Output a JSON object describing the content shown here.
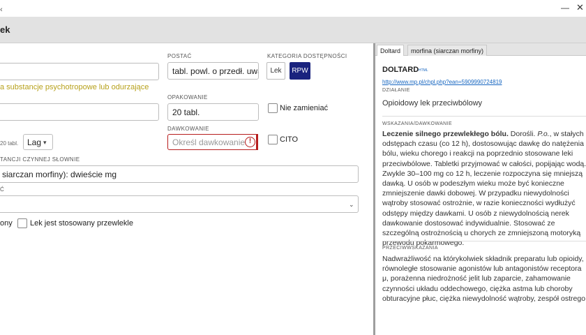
{
  "window": {
    "title_fragment": "ek"
  },
  "form": {
    "postac_label": "POSTAĆ",
    "postac_value": "tabl. powl. o przedł. uwaln",
    "kategoria_label": "KATEGORIA DOSTĘPNOŚCI",
    "kategoria_options": [
      "Lek",
      "RPW"
    ],
    "kategoria_selected": "RPW",
    "warning_text": "a substancje psychotropowe lub odurzające",
    "opakowanie_label": "OPAKOWANIE",
    "opakowanie_value": "20 tabl.",
    "nie_zamieniac_label": "Nie zamieniać",
    "dawkowanie_label": "DAWKOWANIE",
    "dawkowanie_placeholder": "Określ dawkowanie",
    "cito_label": "CITO",
    "pack_small": "20 tabl.",
    "unit_select_value": "Lag",
    "substancja_label": "TANCJI CZYNNEJ SŁOWNIE",
    "substancja_value": "siarczan morfiny): dwieście mg",
    "field_c_label": "Ć",
    "chk_left_label": "ony",
    "przewlekle_label": "Lek jest stosowany przewlekle"
  },
  "right_panel": {
    "tabs": [
      "Doltard",
      "morfina (siarczan morfiny)"
    ],
    "active_tab": "Doltard",
    "drug_name": "DOLTARD",
    "drug_badge": "HTML",
    "drug_link": "http://www.mp.pl/chpl.php?ean=5909990724819",
    "dzialanie_label": "DZIAŁANIE",
    "dzialanie_text": "Opioidowy lek przeciwbólowy",
    "wskazania_label": "WSKAZANIA/DAWKOWANIE",
    "wskazania_heading": "Leczenie silnego przewlekłego bólu.",
    "wskazania_adults": "Dorośli.",
    "wskazania_po": "P.o.",
    "wskazania_rest": ", w stałych odstępach czasu (co 12 h), dostosowując dawkę do natężenia bólu, wieku chorego i reakcji na poprzednio stosowane leki przeciwbólowe. Tabletki przyjmować w całości, popijając wodą. Zwykle 30–100 mg co 12 h, leczenie rozpoczyna się mniejszą dawką. U osób w podeszłym wieku może być konieczne zmniejszenie dawki dobowej. W przypadku niewydolności wątroby stosować ostrożnie, w razie konieczności wydłużyć odstępy między dawkami. U osób z niewydolnością nerek dawkowanie dostosować indywidualnie. Stosować ze szczególną ostrożnością u chorych ze zmniejszoną motoryką przewodu pokarmowego.",
    "przeciw_label": "PRZECIWWSKAZANIA",
    "przeciw_text": "Nadwrażliwość na którykolwiek składnik preparatu lub opioidy, równoległe stosowanie agonistów lub antagonistów receptora μ, porażenna niedrożność jelit lub zaparcie, zahamowanie czynności układu oddechowego, ciężka astma lub choroby obturacyjne płuc, ciężka niewydolność wątroby, zespół ostrego"
  },
  "colors": {
    "accent": "#1a237e",
    "warning": "#b7a11b",
    "error": "#b71c1c",
    "link": "#1565c0"
  }
}
